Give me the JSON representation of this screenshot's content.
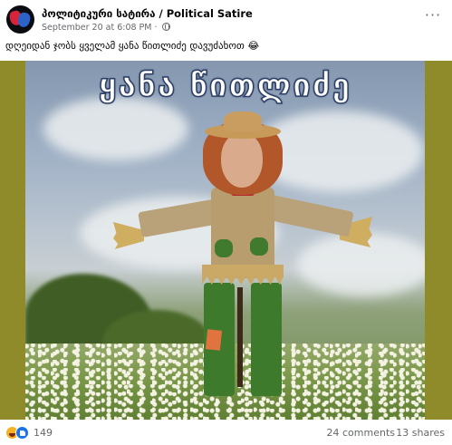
{
  "post": {
    "page_name": "პოლიტიკური სატირა / Political Satire",
    "timestamp": "September 20 at 6:08 PM",
    "privacy_icon": "globe-icon",
    "more_icon": "more-options-icon",
    "more_label": "···",
    "caption": "დღეიდან ჯობს ყველამ ყანა წითლიძე დავუძახოთ 😂"
  },
  "photo": {
    "overlay_title": "ყანა წითლიძე",
    "background_color": "#8f8a2a",
    "title_stroke_color": "#2d3f66"
  },
  "footer": {
    "reaction_icons": [
      "haha-icon",
      "like-icon"
    ],
    "reaction_count": "149",
    "comments": "24 comments",
    "shares": "13 shares"
  },
  "colors": {
    "text_primary": "#050505",
    "text_secondary": "#65676b",
    "like_blue": "#1b74e4",
    "haha_yellow": "#f7b125"
  }
}
